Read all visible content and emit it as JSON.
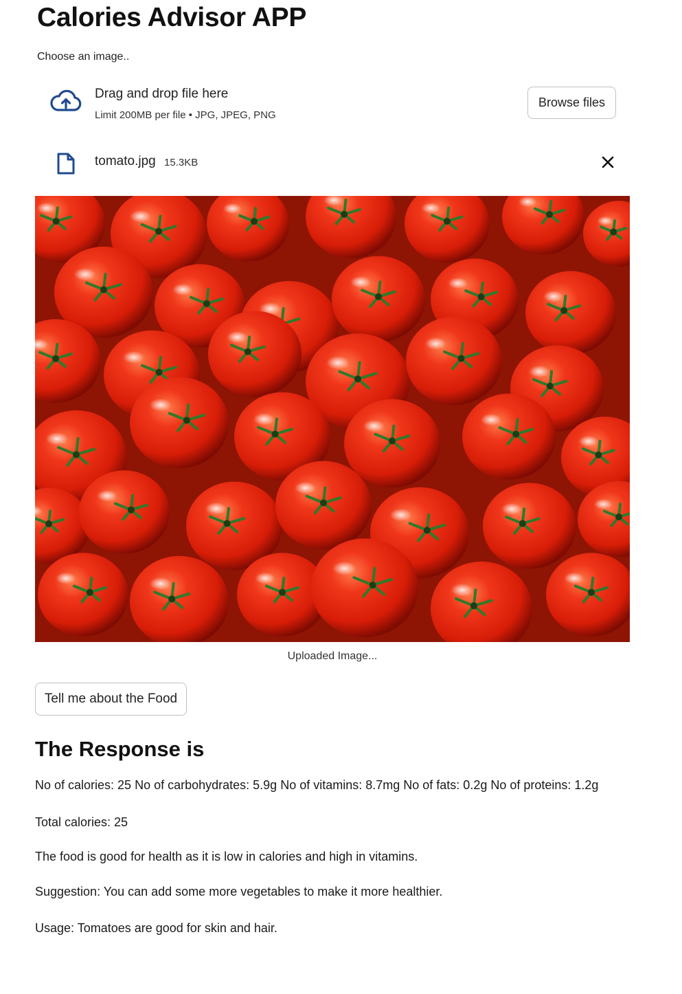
{
  "app": {
    "title": "Calories Advisor APP"
  },
  "uploader": {
    "label": "Choose an image..",
    "drop_text": "Drag and drop file here",
    "limit_text": "Limit 200MB per file • JPG, JPEG, PNG",
    "browse_label": "Browse files",
    "cloud_icon": "cloud-upload-icon"
  },
  "file": {
    "name": "tomato.jpg",
    "size": "15.3KB",
    "file_icon": "file-icon",
    "remove_icon": "close-icon"
  },
  "image": {
    "caption": "Uploaded Image..."
  },
  "actions": {
    "submit_label": "Tell me about the Food"
  },
  "response": {
    "heading": "The Response is",
    "nutrition": "No of calories: 25 No of carbohydrates: 5.9g No of vitamins: 8.7mg No of fats: 0.2g No of proteins: 1.2g",
    "total": "Total calories: 25",
    "health": "The food is good for health as it is low in calories and high in vitamins.",
    "suggestion": "Suggestion: You can add some more vegetables to make it more healthier.",
    "usage": "Usage: Tomatoes are good for skin and hair."
  },
  "colors": {
    "icon_blue": "#1f4a8f",
    "tomato_red": "#e0250c",
    "stem_green": "#2f7a2a"
  }
}
